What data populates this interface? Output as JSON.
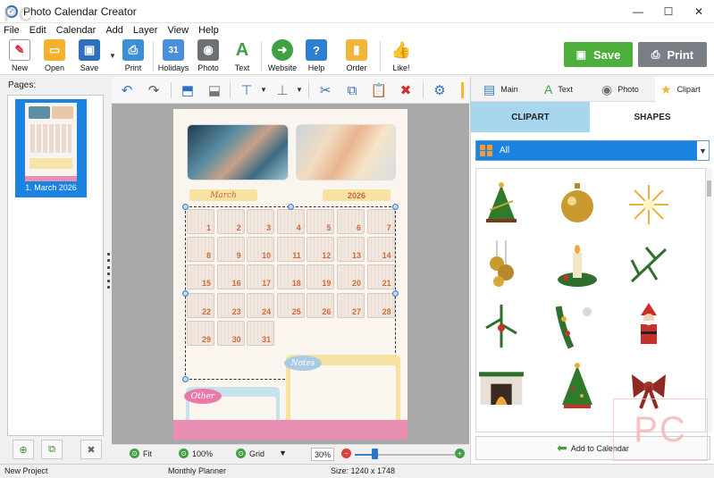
{
  "window": {
    "title": "Photo Calendar Creator"
  },
  "menu": [
    "File",
    "Edit",
    "Calendar",
    "Add",
    "Layer",
    "View",
    "Help"
  ],
  "toolbar": {
    "new": "New",
    "open": "Open",
    "save": "Save",
    "print": "Print",
    "holidays": "Holidays",
    "photo": "Photo",
    "text": "Text",
    "website": "Website",
    "help": "Help",
    "order": "Order",
    "like": "Like!",
    "holidays_badge": "31",
    "text_glyph": "A"
  },
  "actions": {
    "save": "Save",
    "print": "Print"
  },
  "pages": {
    "label": "Pages:",
    "items": [
      {
        "label": "1. March 2026"
      }
    ]
  },
  "calendar": {
    "month": "March",
    "year": "2026",
    "days": [
      "1",
      "2",
      "3",
      "4",
      "5",
      "6",
      "7",
      "8",
      "9",
      "10",
      "11",
      "12",
      "13",
      "14",
      "15",
      "16",
      "17",
      "18",
      "19",
      "20",
      "21",
      "22",
      "23",
      "24",
      "25",
      "26",
      "27",
      "28",
      "29",
      "30",
      "31"
    ],
    "notes_label": "Notes",
    "other_label": "Other"
  },
  "zoom": {
    "fit": "Fit",
    "percent": "100%",
    "grid": "Grid",
    "value": "30%",
    "level": 0.2
  },
  "right_panel": {
    "tabs": [
      "Main",
      "Text",
      "Photo",
      "Clipart"
    ],
    "active_tab": "Clipart",
    "sub_tabs": [
      "CLIPART",
      "SHAPES"
    ],
    "active_sub_tab": "CLIPART",
    "category": "All",
    "clipart": [
      "christmas-tree-small-icon",
      "ornament-ball-icon",
      "golden-sparkle-icon",
      "hanging-ornaments-icon",
      "candle-pine-icon",
      "pine-branch-icon",
      "holly-branch-icon",
      "garland-icon",
      "santa-claus-icon",
      "fireplace-icon",
      "decorated-tree-icon",
      "red-bow-icon"
    ],
    "add_button": "Add to Calendar"
  },
  "status": {
    "project": "New Project",
    "template": "Monthly Planner",
    "size": "Size: 1240 x 1748"
  },
  "watermark": {
    "top_left": "PC",
    "bottom_right": "PC"
  },
  "colors": {
    "accent": "#1a82e0",
    "save_green": "#4caf3c",
    "print_gray": "#7a7f86",
    "calendar_pink": "#e88fb3",
    "calendar_yellow": "#f8e2a2"
  }
}
